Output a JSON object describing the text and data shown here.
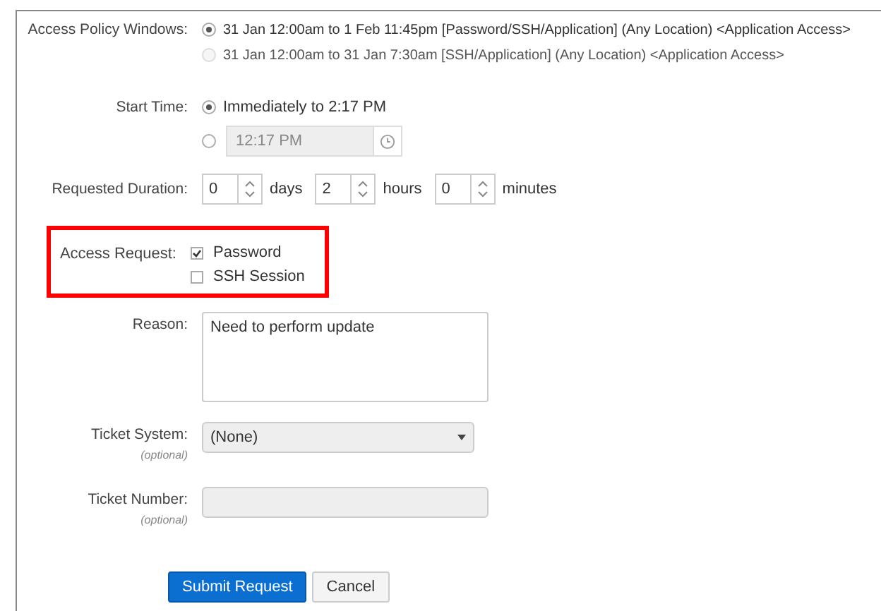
{
  "access_policy_windows": {
    "label": "Access Policy Windows:",
    "options": [
      {
        "text": "31 Jan 12:00am to 1 Feb 11:45pm [Password/SSH/Application] (Any Location) <Application Access>",
        "selected": true,
        "disabled": false
      },
      {
        "text": "31 Jan 12:00am to 31 Jan 7:30am [SSH/Application] (Any Location) <Application Access>",
        "selected": false,
        "disabled": true
      }
    ]
  },
  "start_time": {
    "label": "Start Time:",
    "options": [
      {
        "kind": "text",
        "text": "Immediately to 2:17 PM",
        "selected": true
      },
      {
        "kind": "time",
        "value": "12:17 PM",
        "selected": false
      }
    ]
  },
  "requested_duration": {
    "label": "Requested Duration:",
    "fields": [
      {
        "value": "0",
        "unit": "days"
      },
      {
        "value": "2",
        "unit": "hours"
      },
      {
        "value": "0",
        "unit": "minutes"
      }
    ]
  },
  "access_request": {
    "label": "Access Request:",
    "highlighted": true,
    "options": [
      {
        "label": "Password",
        "checked": true
      },
      {
        "label": "SSH Session",
        "checked": false
      }
    ]
  },
  "reason": {
    "label": "Reason:",
    "value": "Need to perform update"
  },
  "ticket_system": {
    "label": "Ticket System:",
    "note": "(optional)",
    "value": "(None)"
  },
  "ticket_number": {
    "label": "Ticket Number:",
    "note": "(optional)"
  },
  "buttons": [
    {
      "label": "Submit Request",
      "kind": "primary"
    },
    {
      "label": "Cancel",
      "kind": "default"
    }
  ]
}
